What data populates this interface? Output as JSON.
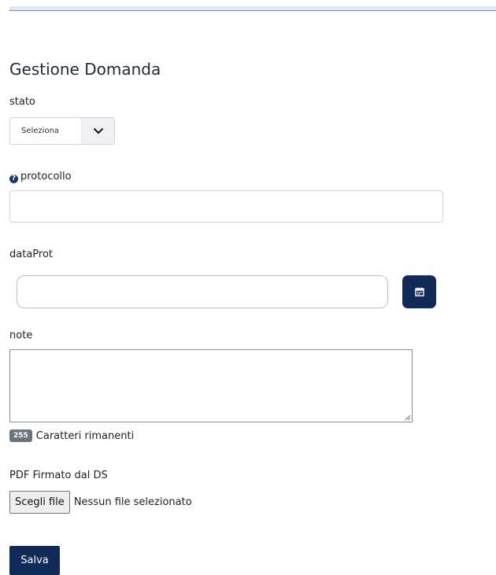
{
  "form": {
    "title": "Gestione Domanda",
    "stato": {
      "label": "stato",
      "selected": "Seleziona",
      "icon": "chevron-down-icon"
    },
    "protocollo": {
      "label": "protocollo",
      "help_icon": "question-circle-icon",
      "value": ""
    },
    "dataProt": {
      "label": "dataProt",
      "value": "",
      "button_icon": "calendar-icon"
    },
    "note": {
      "label": "note",
      "value": "",
      "remaining_count": "255",
      "remaining_text": "Caratteri rimanenti"
    },
    "pdf": {
      "label": "PDF Firmato dal DS",
      "button_label": "Scegli file",
      "status_text": "Nessun file selezionato"
    },
    "save_label": "Salva"
  },
  "colors": {
    "primary": "#0f2a57",
    "badge": "#6c757d",
    "header_rule": "#dbe9f8"
  }
}
